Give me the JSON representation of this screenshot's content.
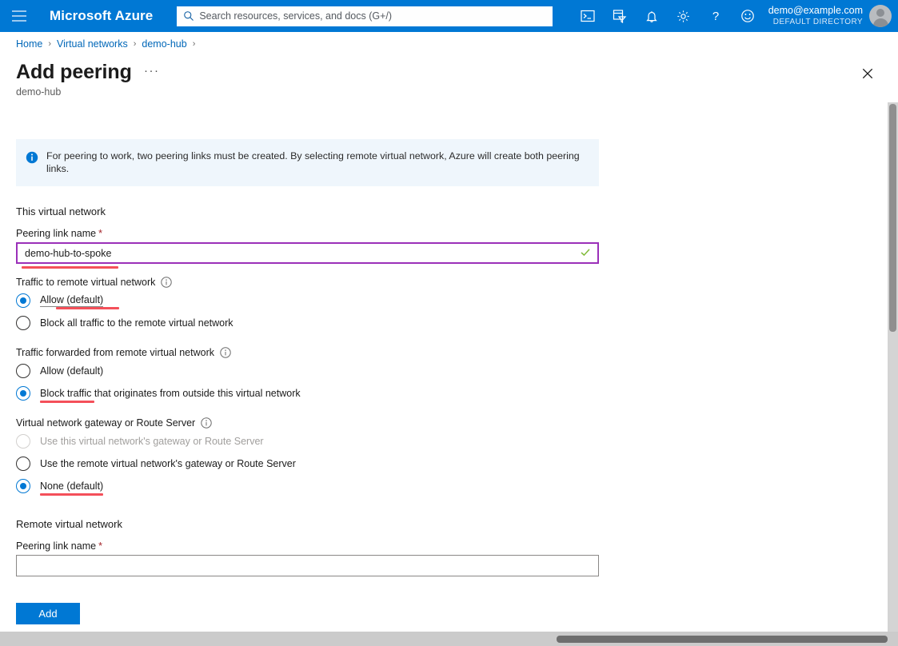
{
  "topbar": {
    "menu_icon": "hamburger-icon",
    "brand": "Microsoft Azure",
    "search_placeholder": "Search resources, services, and docs (G+/)",
    "icons": [
      {
        "name": "cloud-shell-icon",
        "title": "Cloud Shell"
      },
      {
        "name": "directories-subscriptions-icon",
        "title": "Directories + subscriptions"
      },
      {
        "name": "notifications-bell-icon",
        "title": "Notifications"
      },
      {
        "name": "settings-gear-icon",
        "title": "Settings"
      },
      {
        "name": "help-question-icon",
        "title": "Help"
      },
      {
        "name": "feedback-smiley-icon",
        "title": "Feedback"
      }
    ],
    "account_email": "demo@example.com",
    "account_directory": "DEFAULT DIRECTORY"
  },
  "breadcrumb": {
    "items": [
      "Home",
      "Virtual networks",
      "demo-hub"
    ],
    "separator": "›"
  },
  "blade": {
    "title": "Add peering",
    "ellipsis": "···",
    "subtitle": "demo-hub",
    "close_label": "Close"
  },
  "info_banner": {
    "icon": "info-circle-icon",
    "text": "For peering to work, two peering links must be created. By selecting remote virtual network, Azure will create both peering links."
  },
  "this_vnet": {
    "section_title": "This virtual network",
    "peering_link_name": {
      "label": "Peering link name",
      "required_mark": "*",
      "value": "demo-hub-to-spoke",
      "placeholder": "",
      "validated": true,
      "focused": true
    },
    "traffic_to_remote": {
      "label": "Traffic to remote virtual network",
      "info_icon": "info-circle-icon",
      "options": [
        {
          "label": "Allow (default)",
          "selected": true,
          "disabled": false,
          "annotated": true
        },
        {
          "label": "Block all traffic to the remote virtual network",
          "selected": false,
          "disabled": false,
          "annotated": false
        }
      ]
    },
    "traffic_forwarded": {
      "label": "Traffic forwarded from remote virtual network",
      "info_icon": "info-circle-icon",
      "options": [
        {
          "label": "Allow (default)",
          "selected": false,
          "disabled": false,
          "annotated": false
        },
        {
          "label": "Block traffic that originates from outside this virtual network",
          "selected": true,
          "disabled": false,
          "annotated": true
        }
      ]
    },
    "gateway_or_route_server": {
      "label": "Virtual network gateway or Route Server",
      "info_icon": "info-circle-icon",
      "options": [
        {
          "label": "Use this virtual network's gateway or Route Server",
          "selected": false,
          "disabled": true,
          "annotated": false
        },
        {
          "label": "Use the remote virtual network's gateway or Route Server",
          "selected": false,
          "disabled": false,
          "annotated": false
        },
        {
          "label": "None (default)",
          "selected": true,
          "disabled": false,
          "annotated": true
        }
      ]
    }
  },
  "remote_vnet": {
    "section_title": "Remote virtual network",
    "peering_link_name": {
      "label": "Peering link name",
      "required_mark": "*",
      "value": "",
      "placeholder": ""
    }
  },
  "footer": {
    "add_label": "Add"
  },
  "colors": {
    "azure_blue": "#0078d4",
    "banner_bg": "#eff6fc",
    "link_blue": "#0067b8",
    "required_red": "#a4262c",
    "annotation_red": "#f4505a",
    "focus_purple": "#9b30b9",
    "validate_green": "#7fba37"
  },
  "scrollbars": {
    "vertical_name": "vertical-scrollbar",
    "horizontal_name": "horizontal-scrollbar"
  }
}
